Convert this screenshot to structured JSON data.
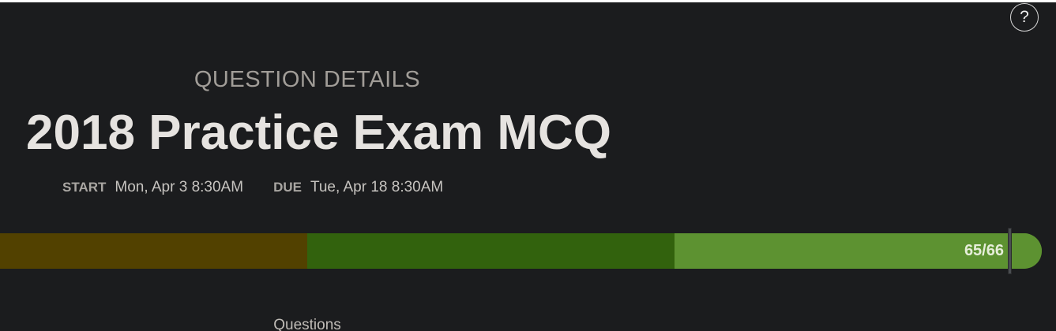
{
  "header": {
    "help_label": "?",
    "section_title": "QUESTION DETAILS",
    "exam_title": "2018 Practice Exam MCQ"
  },
  "dates": {
    "start_label": "START",
    "start_value": "Mon, Apr 3 8:30AM",
    "due_label": "DUE",
    "due_value": "Tue, Apr 18 8:30AM"
  },
  "progress": {
    "count_text": "65/66",
    "answered": 65,
    "total": 66,
    "colors": {
      "first_segment": "#524100",
      "second_segment": "#32620d",
      "third_segment": "#5d9231"
    }
  },
  "content": {
    "questions_label": "Questions"
  }
}
